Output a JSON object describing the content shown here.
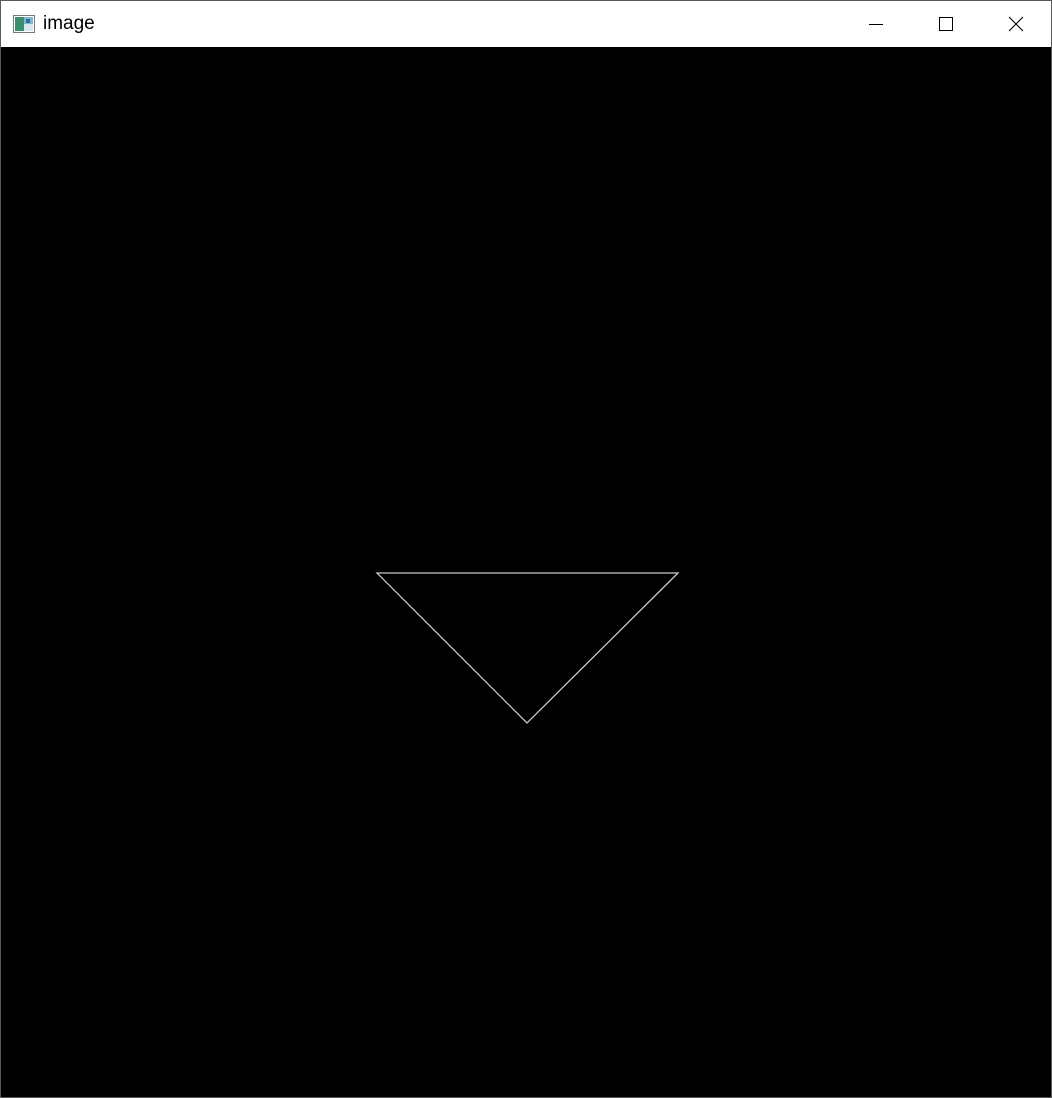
{
  "window": {
    "title": "image",
    "icon": "image-window-icon",
    "controls": [
      "minimize-icon",
      "maximize-icon",
      "close-icon"
    ]
  },
  "canvas": {
    "background": "#000000",
    "shape": {
      "type": "triangle",
      "orientation": "pointing-down",
      "stroke": "#c8c8c8",
      "fill": "none"
    }
  }
}
